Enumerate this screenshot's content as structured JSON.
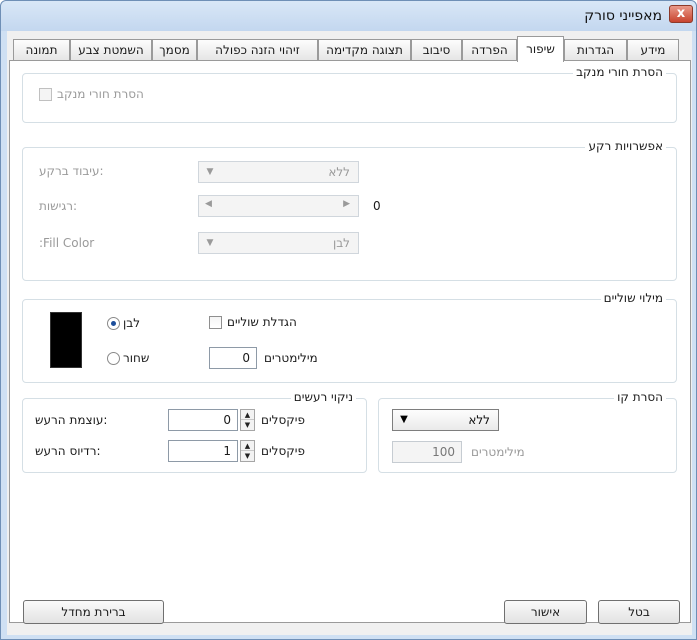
{
  "window": {
    "title": "מאפייני סורק",
    "close_label": "x"
  },
  "tabs": [
    {
      "label": "מידע"
    },
    {
      "label": "הגדרות"
    },
    {
      "label": "שיפור"
    },
    {
      "label": "הפרדה"
    },
    {
      "label": "סיבוב"
    },
    {
      "label": "תצוגה מקדימה"
    },
    {
      "label": "זיהוי הזנה כפולה"
    },
    {
      "label": "מסמך"
    },
    {
      "label": "השמטת צבע"
    },
    {
      "label": "תמונה"
    }
  ],
  "hole_removal": {
    "title": "הסרת חורי מנקב",
    "checkbox_label": "הסרת חורי מנקב",
    "checked": false,
    "disabled": true
  },
  "background": {
    "title": "אפשרויות רקע",
    "processing_label": ":עיבוד ברקע",
    "processing_value": "ללא",
    "sensitivity_label": ":רגישות",
    "sensitivity_value": "0",
    "fill_color_label": "Fill Color:",
    "fill_color_value": "לבן"
  },
  "edge_fill": {
    "title": "מילוי שוליים",
    "white_label": "לבן",
    "black_label": "שחור",
    "selected": "white",
    "extend_label": "הגדלת שוליים",
    "extend_checked": false,
    "mm_value": "0",
    "mm_label": "מילימטרים"
  },
  "noise_removal": {
    "title": "ניקוי רעשים",
    "density_label": ":עוצמת הרעש",
    "density_value": "0",
    "density_unit": "פיקסלים",
    "radius_label": ":רדיוס הרעש",
    "radius_value": "1",
    "radius_unit": "פיקסלים"
  },
  "streak_removal": {
    "title": "הסרת קו",
    "mode_value": "ללא",
    "mm_value": "100",
    "mm_label": "מילימטרים"
  },
  "buttons": {
    "default": "ברירת מחדל",
    "ok": "אישור",
    "cancel": "בטל"
  }
}
